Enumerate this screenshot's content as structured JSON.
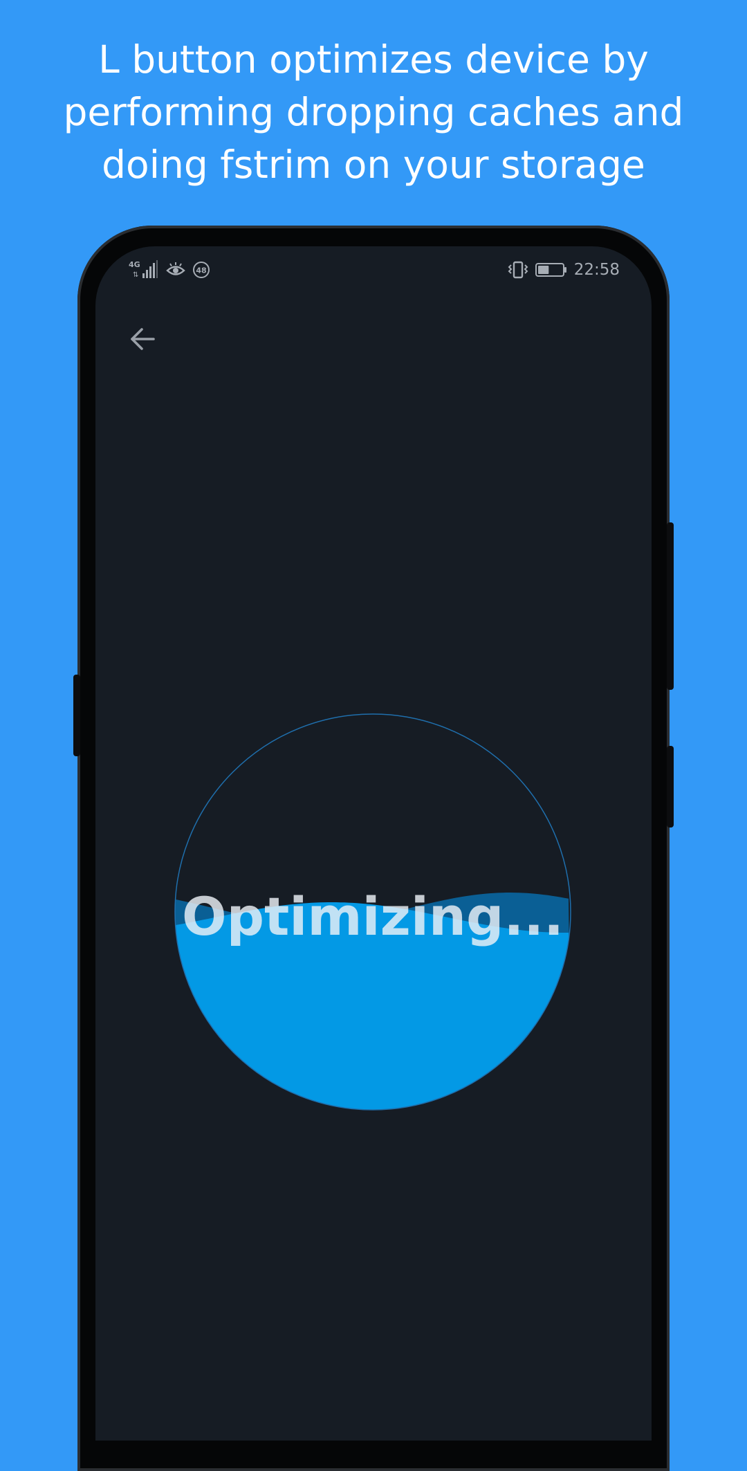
{
  "header": {
    "lines": [
      "L button optimizes device by",
      "performing dropping caches and",
      "doing fstrim on your storage"
    ]
  },
  "status_bar": {
    "network": "4G",
    "badge": "48",
    "time": "22:58",
    "battery_fill": 0.45
  },
  "toolbar": {
    "back_icon": "arrow-left-icon"
  },
  "progress": {
    "label": "Optimizing...",
    "fill_fraction": 0.5,
    "colors": {
      "water": "#0399e5",
      "back_wave": "#0a5f95",
      "ring": "#1f6fad"
    }
  },
  "colors": {
    "page_background": "#3399f7",
    "screen_background": "#161c24"
  }
}
